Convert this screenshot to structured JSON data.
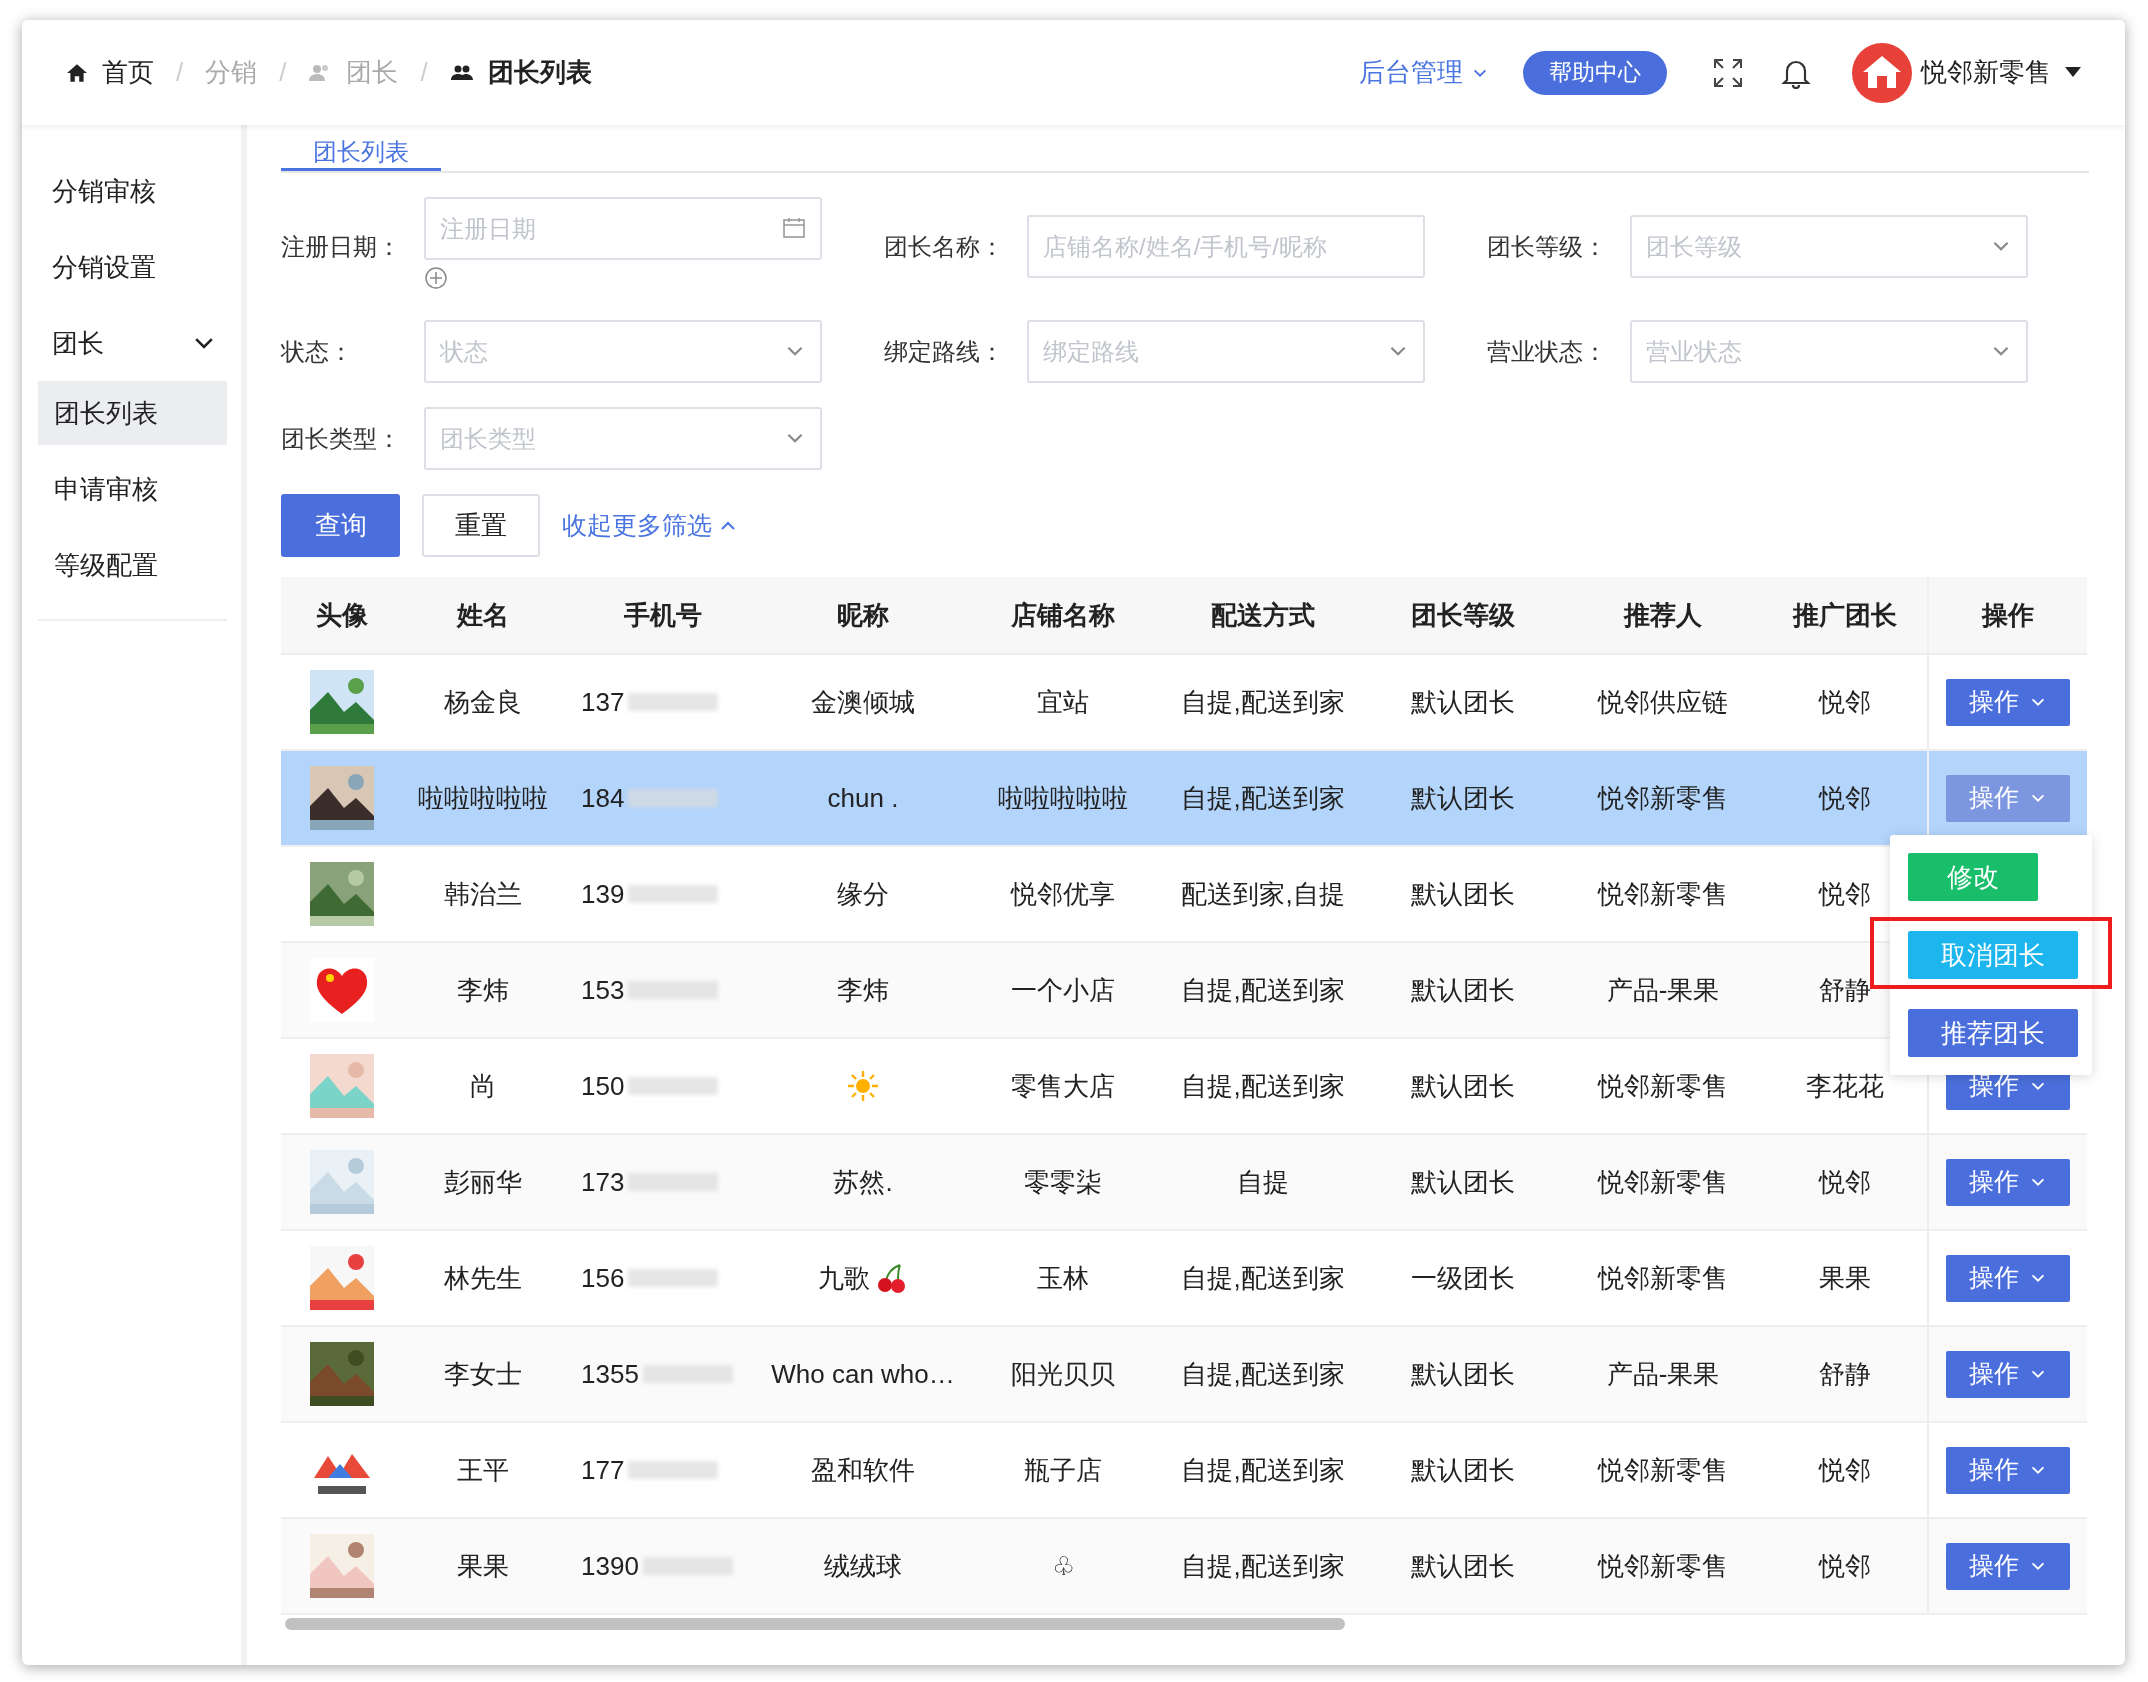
{
  "breadcrumb": [
    {
      "label": "首页",
      "kind": "home",
      "current": false
    },
    {
      "separator": "/",
      "label": "分销",
      "kind": "plain",
      "current": false
    },
    {
      "separator": "/",
      "label": "团长",
      "kind": "people",
      "current": false
    },
    {
      "separator": "/",
      "label": "团长列表",
      "kind": "group",
      "current": true
    }
  ],
  "header": {
    "admin_menu": "后台管理",
    "help": "帮助中心",
    "user": "悦邻新零售"
  },
  "sidebar": [
    {
      "label": "分销审核",
      "selected": false
    },
    {
      "label": "分销设置",
      "selected": false
    },
    {
      "label": "团长",
      "selected": false,
      "expanded": true,
      "children": [
        {
          "label": "团长列表",
          "selected": true
        },
        {
          "label": "申请审核",
          "selected": false
        },
        {
          "label": "等级配置",
          "selected": false
        }
      ]
    }
  ],
  "tabs": [
    {
      "label": "团长列表",
      "selected": true
    }
  ],
  "filters": [
    {
      "label": "注册日期：",
      "placeholder": "注册日期",
      "kind": "date"
    },
    {
      "label": "团长名称：",
      "placeholder": "店铺名称/姓名/手机号/昵称",
      "kind": "text"
    },
    {
      "label": "团长等级：",
      "placeholder": "团长等级",
      "kind": "select"
    },
    {
      "label": "状态：",
      "placeholder": "状态",
      "kind": "select"
    },
    {
      "label": "绑定路线：",
      "placeholder": "绑定路线",
      "kind": "select"
    },
    {
      "label": "营业状态：",
      "placeholder": "营业状态",
      "kind": "select"
    },
    {
      "label": "团长类型：",
      "placeholder": "团长类型",
      "kind": "select"
    }
  ],
  "buttons": {
    "query": "查询",
    "reset": "重置",
    "collapse": "收起更多筛选"
  },
  "table": {
    "columns": [
      "头像",
      "姓名",
      "手机号",
      "昵称",
      "店铺名称",
      "配送方式",
      "团长等级",
      "推荐人",
      "推广团长",
      "操作"
    ],
    "rows": [
      {
        "name": "杨金良",
        "phone": "137",
        "nickname": "金澳倾城",
        "store": "宜站",
        "delivery": "自提,配送到家",
        "level": "默认团长",
        "referrer": "悦邻供应链",
        "promoter": "悦邻",
        "action": "操作",
        "selected": false
      },
      {
        "name": "啦啦啦啦啦",
        "phone": "184",
        "nickname": "chun .",
        "store": "啦啦啦啦啦",
        "delivery": "自提,配送到家",
        "level": "默认团长",
        "referrer": "悦邻新零售",
        "promoter": "悦邻",
        "action": "操作",
        "selected": true
      },
      {
        "name": "韩治兰",
        "phone": "139",
        "nickname": "缘分",
        "store": "悦邻优享",
        "delivery": "配送到家,自提",
        "level": "默认团长",
        "referrer": "悦邻新零售",
        "promoter": "悦邻",
        "selected": false
      },
      {
        "name": "李炜",
        "phone": "153",
        "nickname": "李炜",
        "store": "一个小店",
        "delivery": "自提,配送到家",
        "level": "默认团长",
        "referrer": "产品-果果",
        "promoter": "舒静",
        "selected": false
      },
      {
        "name": "尚",
        "phone": "150",
        "kind": "sun",
        "store": "零售大店",
        "delivery": "自提,配送到家",
        "level": "默认团长",
        "referrer": "悦邻新零售",
        "promoter": "李花花",
        "action": "操作",
        "selected": false
      },
      {
        "name": "彭丽华",
        "phone": "173",
        "nickname": "苏然.",
        "store": "零零柒",
        "delivery": "自提",
        "level": "默认团长",
        "referrer": "悦邻新零售",
        "promoter": "悦邻",
        "action": "操作",
        "selected": false
      },
      {
        "name": "林先生",
        "phone": "156",
        "nickname": "九歌",
        "kind": "cherry",
        "store": "玉林",
        "delivery": "自提,配送到家",
        "level": "一级团长",
        "referrer": "悦邻新零售",
        "promoter": "果果",
        "action": "操作",
        "selected": false
      },
      {
        "name": "李女士",
        "phone": "1355",
        "nickname": "Who can who…",
        "store": "阳光贝贝",
        "delivery": "自提,配送到家",
        "level": "默认团长",
        "referrer": "产品-果果",
        "promoter": "舒静",
        "action": "操作",
        "selected": false
      },
      {
        "name": "王平",
        "phone": "177",
        "nickname": "盈和软件",
        "store": "瓶子店",
        "delivery": "自提,配送到家",
        "level": "默认团长",
        "referrer": "悦邻新零售",
        "promoter": "悦邻",
        "action": "操作",
        "selected": false
      },
      {
        "name": "果果",
        "phone": "1390",
        "nickname": "绒绒球",
        "store": "♧",
        "delivery": "自提,配送到家",
        "level": "默认团长",
        "referrer": "悦邻新零售",
        "promoter": "悦邻",
        "action": "操作",
        "selected": false
      }
    ]
  },
  "action_menu": {
    "items": [
      {
        "label": "修改",
        "kind": "edit",
        "highlighted": false
      },
      {
        "label": "取消团长",
        "kind": "cancel",
        "highlighted": true
      },
      {
        "label": "推荐团长",
        "kind": "recommend",
        "highlighted": false
      }
    ]
  }
}
